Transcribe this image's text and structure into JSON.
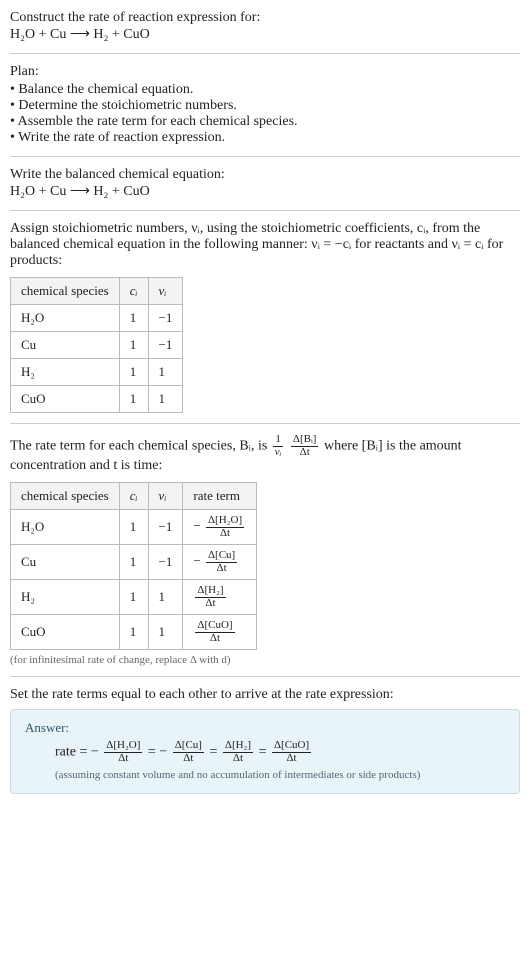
{
  "header": {
    "title": "Construct the rate of reaction expression for:",
    "equation": "H₂O + Cu ⟶ H₂ + CuO"
  },
  "plan": {
    "heading": "Plan:",
    "items": [
      "Balance the chemical equation.",
      "Determine the stoichiometric numbers.",
      "Assemble the rate term for each chemical species.",
      "Write the rate of reaction expression."
    ]
  },
  "balanced": {
    "heading": "Write the balanced chemical equation:",
    "equation": "H₂O + Cu ⟶ H₂ + CuO"
  },
  "stoich": {
    "intro_a": "Assign stoichiometric numbers, νᵢ, using the stoichiometric coefficients, cᵢ, from the balanced chemical equation in the following manner: νᵢ = −cᵢ for reactants and νᵢ = cᵢ for products:",
    "cols": [
      "chemical species",
      "cᵢ",
      "νᵢ"
    ],
    "rows": [
      {
        "species": "H₂O",
        "c": "1",
        "v": "−1"
      },
      {
        "species": "Cu",
        "c": "1",
        "v": "−1"
      },
      {
        "species": "H₂",
        "c": "1",
        "v": "1"
      },
      {
        "species": "CuO",
        "c": "1",
        "v": "1"
      }
    ]
  },
  "rateterm": {
    "intro_prefix": "The rate term for each chemical species, Bᵢ, is ",
    "frac1_num": "1",
    "frac1_den": "νᵢ",
    "frac2_num": "Δ[Bᵢ]",
    "frac2_den": "Δt",
    "intro_suffix": " where [Bᵢ] is the amount concentration and t is time:",
    "cols": [
      "chemical species",
      "cᵢ",
      "νᵢ",
      "rate term"
    ],
    "rows": [
      {
        "species": "H₂O",
        "c": "1",
        "v": "−1",
        "rt_sign": "−",
        "rt_num": "Δ[H₂O]",
        "rt_den": "Δt"
      },
      {
        "species": "Cu",
        "c": "1",
        "v": "−1",
        "rt_sign": "−",
        "rt_num": "Δ[Cu]",
        "rt_den": "Δt"
      },
      {
        "species": "H₂",
        "c": "1",
        "v": "1",
        "rt_sign": "",
        "rt_num": "Δ[H₂]",
        "rt_den": "Δt"
      },
      {
        "species": "CuO",
        "c": "1",
        "v": "1",
        "rt_sign": "",
        "rt_num": "Δ[CuO]",
        "rt_den": "Δt"
      }
    ],
    "note": "(for infinitesimal rate of change, replace Δ with d)"
  },
  "final": {
    "heading": "Set the rate terms equal to each other to arrive at the rate expression:",
    "answer_label": "Answer:",
    "rate_prefix": "rate = ",
    "terms": [
      {
        "sign": "−",
        "num": "Δ[H₂O]",
        "den": "Δt"
      },
      {
        "sign": "−",
        "num": "Δ[Cu]",
        "den": "Δt"
      },
      {
        "sign": "",
        "num": "Δ[H₂]",
        "den": "Δt"
      },
      {
        "sign": "",
        "num": "Δ[CuO]",
        "den": "Δt"
      }
    ],
    "assumption": "(assuming constant volume and no accumulation of intermediates or side products)"
  }
}
